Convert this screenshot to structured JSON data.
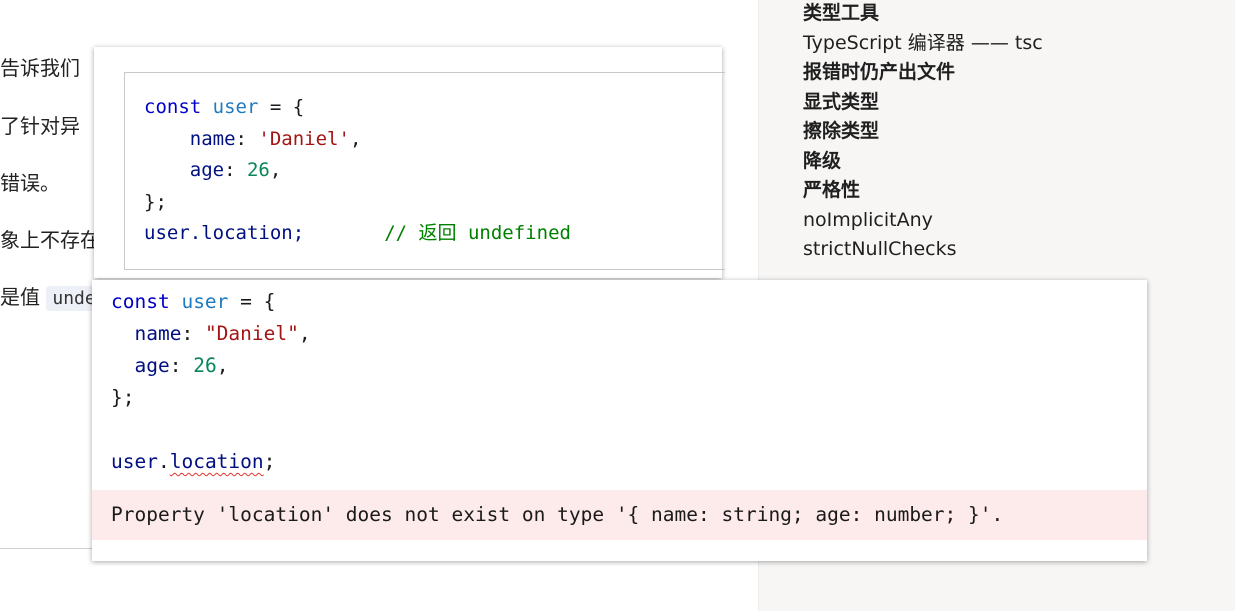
{
  "article": {
    "lines": [
      "告诉我们",
      "了针对异",
      "错误。",
      "象上不存在",
      "是值"
    ],
    "inline_code": "unde"
  },
  "sidebar": {
    "items": [
      {
        "label": "类型工具",
        "strong": true
      },
      {
        "label": "TypeScript 编译器 —— tsc",
        "strong": false
      },
      {
        "label": "报错时仍产出文件",
        "strong": true
      },
      {
        "label": "显式类型",
        "strong": true
      },
      {
        "label": "擦除类型",
        "strong": true
      },
      {
        "label": "降级",
        "strong": true
      },
      {
        "label": "严格性",
        "strong": true
      },
      {
        "label": "noImplicitAny",
        "strong": false
      },
      {
        "label": "strictNullChecks",
        "strong": false
      }
    ]
  },
  "popup1": {
    "code": {
      "kw_const": "const",
      "var_user": "user",
      "eq_open": " = {",
      "indent": "    ",
      "key_name": "name",
      "colon": ": ",
      "val_name": "'Daniel'",
      "comma": ",",
      "key_age": "age",
      "val_age": "26",
      "close": "};",
      "access": "user.location;",
      "gap": "       ",
      "comment": "// 返回 undefined"
    }
  },
  "popup2": {
    "code": {
      "kw_const": "const",
      "var_user": "user",
      "eq_open": " = {",
      "indent": "  ",
      "key_name": "name",
      "colon": ": ",
      "val_name": "\"Daniel\"",
      "comma": ",",
      "key_age": "age",
      "val_age": "26",
      "close": "};",
      "obj": "user",
      "dot": ".",
      "prop": "location",
      "semi": ";"
    },
    "error_message": "Property 'location' does not exist on type '{ name: string; age: number; }'."
  },
  "colors": {
    "keyword": "#0000c8",
    "identifier": "#1f7abf",
    "property": "#001080",
    "string": "#a31515",
    "number": "#098658",
    "comment": "#008000",
    "error_bg": "#fdeaea",
    "squiggle": "#e0362c"
  }
}
